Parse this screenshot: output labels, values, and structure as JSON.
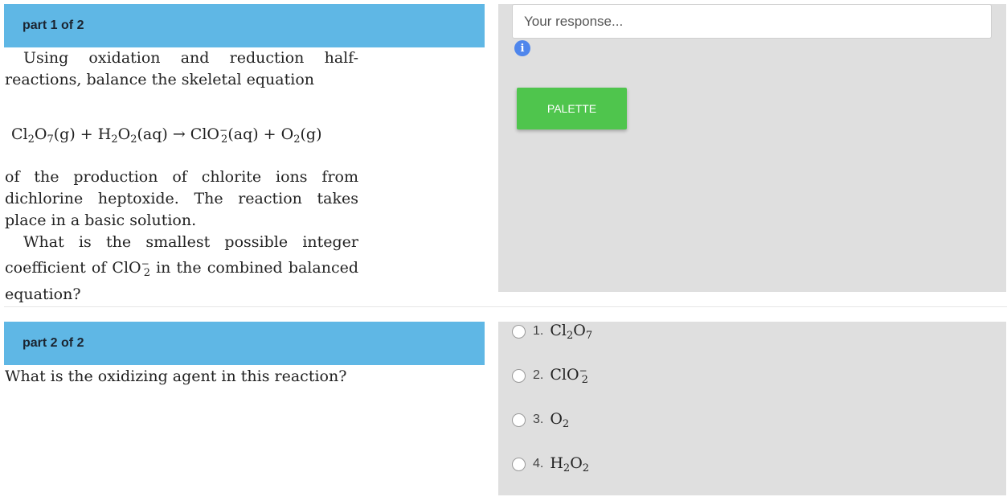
{
  "part1": {
    "header": "part 1 of 2",
    "para1": "Using oxidation and reduction half-reactions, balance the skeletal equation",
    "equation": {
      "t1": "Cl",
      "s1": "2",
      "t2": "O",
      "s2": "7",
      "t3": "(g) + H",
      "s3": "2",
      "t4": "O",
      "s4": "2",
      "t5": "(aq) → ClO",
      "s5": "2",
      "sup5": "−",
      "t6": "(aq) + O",
      "s6": "2",
      "t7": "(g)"
    },
    "para2": "of the production of chlorite ions from dichlorine heptoxide. The reaction takes place in a basic solution.",
    "para3_a": "What is the smallest possible integer coefficient of ClO",
    "para3_sub": "2",
    "para3_sup": "−",
    "para3_b": " in the combined balanced equation?",
    "response_placeholder": "Your response...",
    "info_icon_glyph": "i",
    "palette_label": "PALETTE"
  },
  "part2": {
    "header": "part 2 of 2",
    "question": "What is the oxidizing agent in this reaction?",
    "options": [
      {
        "num": "1.",
        "a": "Cl",
        "b": "2",
        "c": "O",
        "d": "7",
        "sup": ""
      },
      {
        "num": "2.",
        "a": "ClO",
        "b": "2",
        "c": "",
        "d": "",
        "sup": "−"
      },
      {
        "num": "3.",
        "a": "O",
        "b": "2",
        "c": "",
        "d": "",
        "sup": ""
      },
      {
        "num": "4.",
        "a": "H",
        "b": "2",
        "c": "O",
        "d": "2",
        "sup": ""
      }
    ]
  },
  "colors": {
    "header_bg": "#5fb7e5",
    "panel_bg": "#dfdfdf",
    "palette_btn": "#4fc54d",
    "info_icon": "#4f86ec"
  }
}
